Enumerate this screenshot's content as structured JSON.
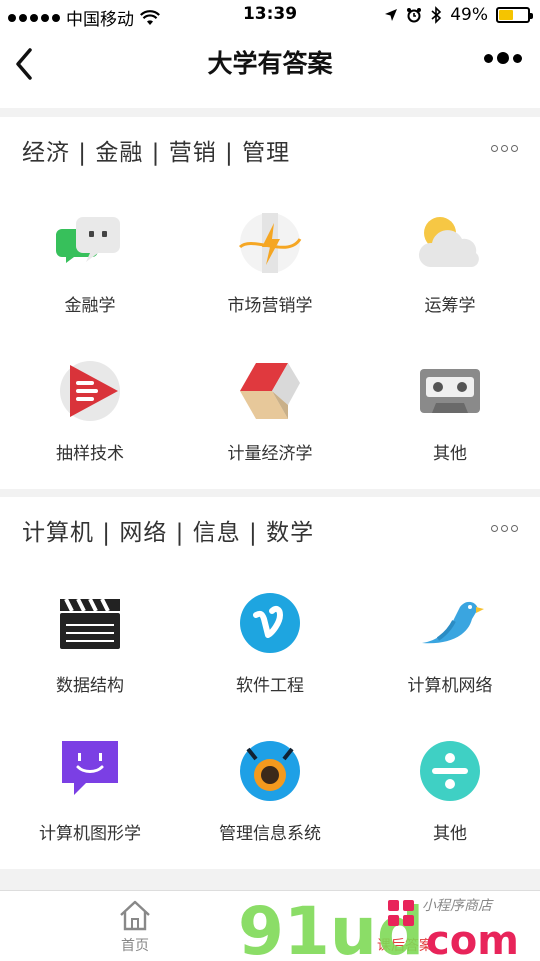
{
  "status_bar": {
    "carrier": "中国移动",
    "time": "13:39",
    "battery_percent": "49%",
    "battery_level": 0.49
  },
  "nav": {
    "title": "大学有答案"
  },
  "sections": [
    {
      "title": "经济 | 金融 | 营销 | 管理",
      "items": [
        {
          "label": "金融学",
          "icon": "chat-bubbles-icon"
        },
        {
          "label": "市场营销学",
          "icon": "lightning-icon"
        },
        {
          "label": "运筹学",
          "icon": "sun-cloud-icon"
        },
        {
          "label": "抽样技术",
          "icon": "play-icon"
        },
        {
          "label": "计量经济学",
          "icon": "cube-icon"
        },
        {
          "label": "其他",
          "icon": "cassette-icon"
        }
      ]
    },
    {
      "title": "计算机 | 网络 | 信息 | 数学",
      "items": [
        {
          "label": "数据结构",
          "icon": "clapperboard-icon"
        },
        {
          "label": "软件工程",
          "icon": "vimeo-icon"
        },
        {
          "label": "计算机网络",
          "icon": "bird-icon"
        },
        {
          "label": "计算机图形学",
          "icon": "twitch-icon"
        },
        {
          "label": "管理信息系统",
          "icon": "camera-bot-icon"
        },
        {
          "label": "其他",
          "icon": "plus-icon"
        }
      ]
    }
  ],
  "tabbar": {
    "home_label": "首页",
    "answers_label": "课后答案"
  },
  "watermark": {
    "text": "91ud",
    "domain": "com",
    "tagline": "小程序商店"
  },
  "colors": {
    "accent_red": "#e23b3b",
    "watermark_green": "#7ed957",
    "watermark_red": "#e8245a"
  }
}
